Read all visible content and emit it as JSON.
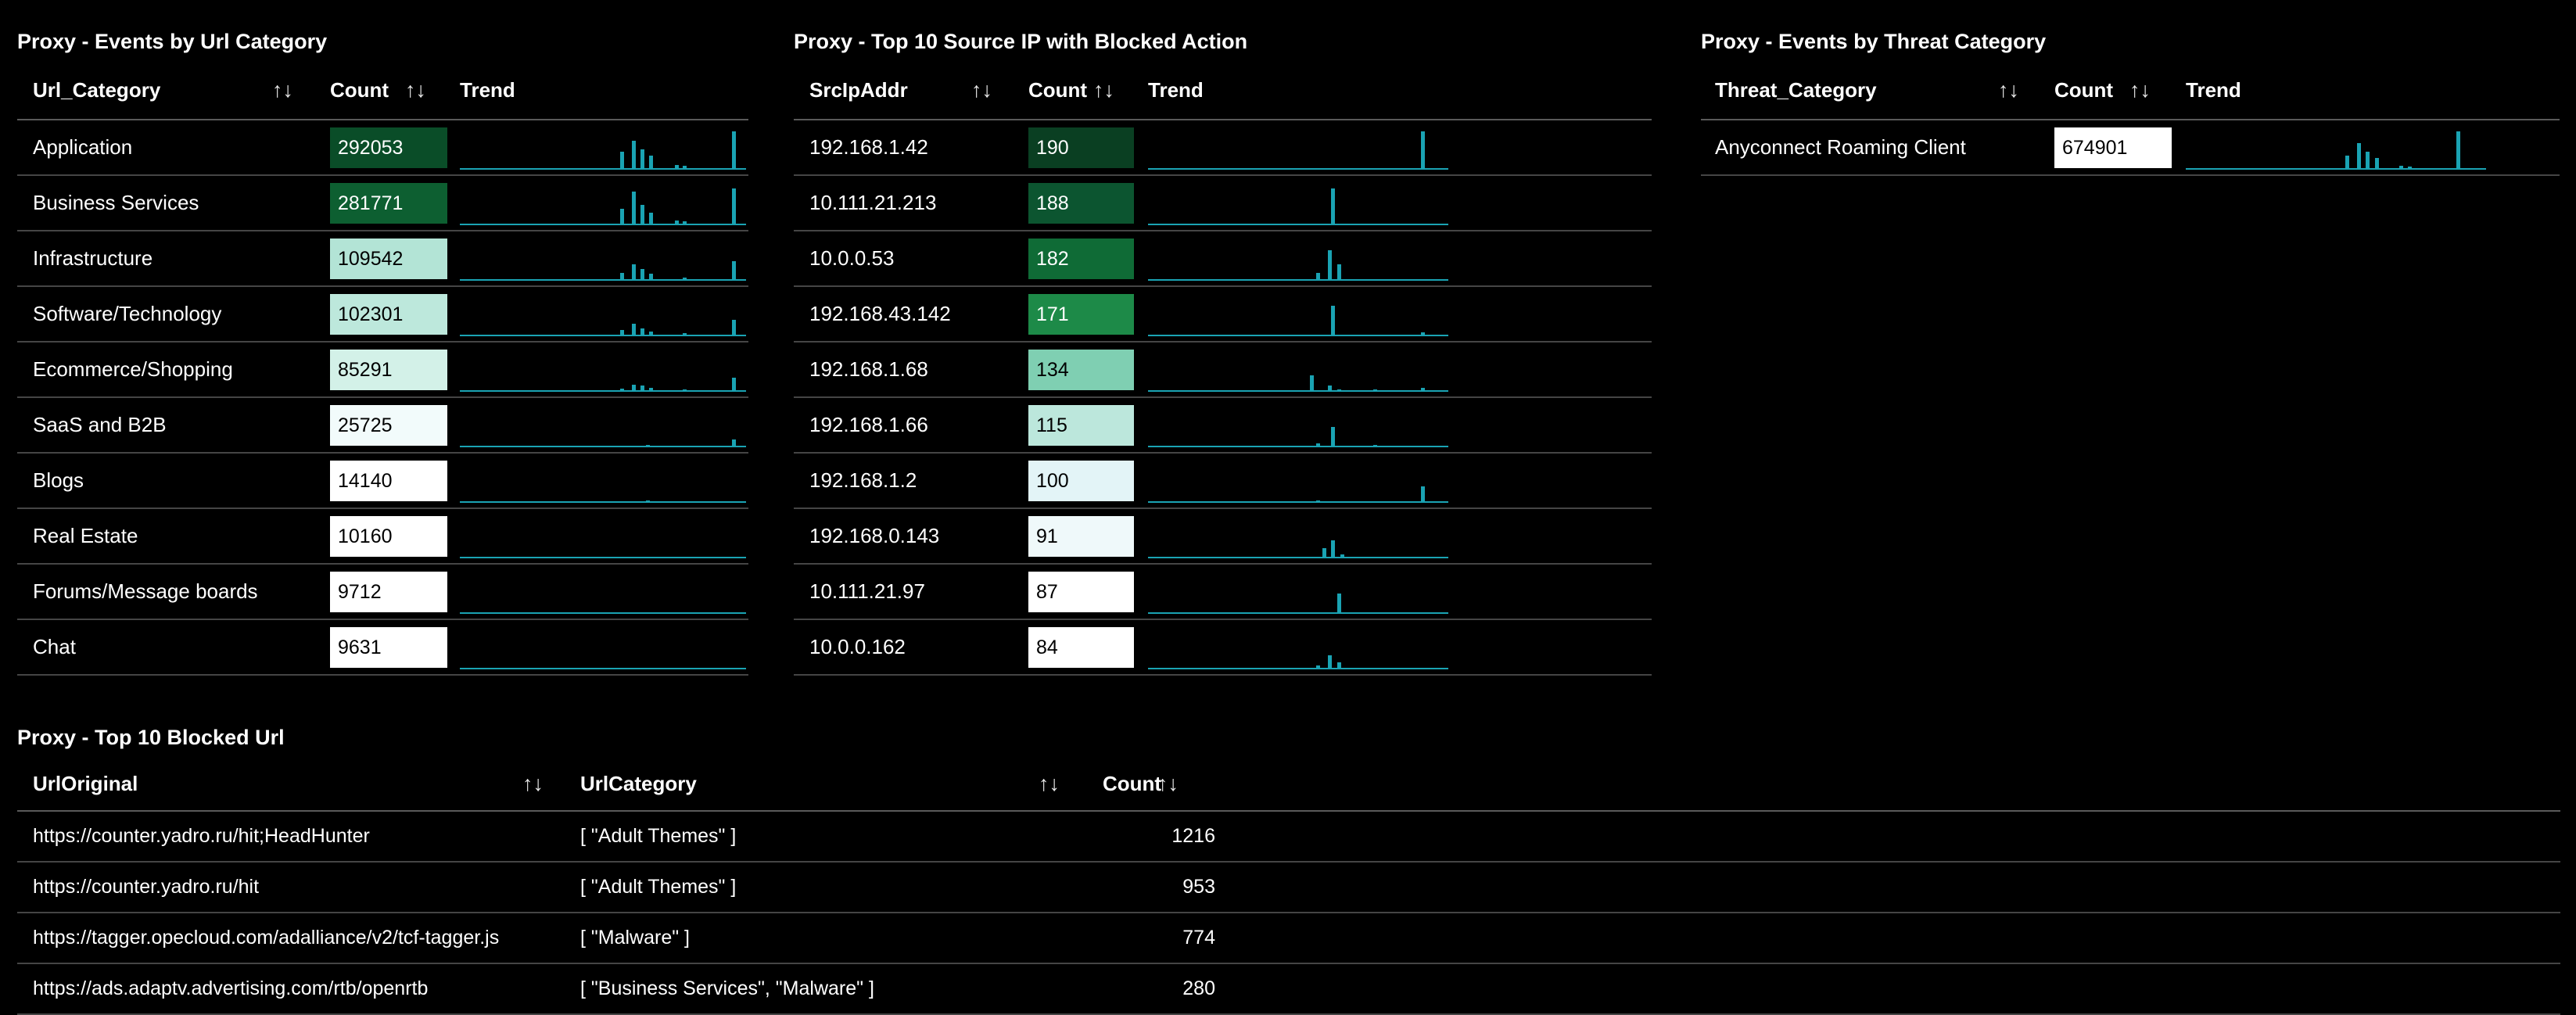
{
  "panels": {
    "url_category": {
      "title": "Proxy - Events by Url Category",
      "columns": [
        "Url_Category",
        "Count",
        "Trend"
      ],
      "rows": [
        {
          "label": "Application",
          "count": "292053",
          "shade": "#0a4d28",
          "fg": "#ffffff"
        },
        {
          "label": "Business Services",
          "count": "281771",
          "shade": "#0d5f31",
          "fg": "#ffffff"
        },
        {
          "label": "Infrastructure",
          "count": "109542",
          "shade": "#b3e4d6",
          "fg": "#000000"
        },
        {
          "label": "Software/Technology",
          "count": "102301",
          "shade": "#bde8dc",
          "fg": "#000000"
        },
        {
          "label": "Ecommerce/Shopping",
          "count": "85291",
          "shade": "#d3f1e8",
          "fg": "#000000"
        },
        {
          "label": "SaaS and B2B",
          "count": "25725",
          "shade": "#f2fbfb",
          "fg": "#000000"
        },
        {
          "label": "Blogs",
          "count": "14140",
          "shade": "#ffffff",
          "fg": "#000000"
        },
        {
          "label": "Real Estate",
          "count": "10160",
          "shade": "#ffffff",
          "fg": "#000000"
        },
        {
          "label": "Forums/Message boards",
          "count": "9712",
          "shade": "#ffffff",
          "fg": "#000000"
        },
        {
          "label": "Chat",
          "count": "9631",
          "shade": "#ffffff",
          "fg": "#000000"
        }
      ]
    },
    "src_ip": {
      "title": "Proxy - Top 10 Source IP with Blocked Action",
      "columns": [
        "SrcIpAddr",
        "Count",
        "Trend"
      ],
      "rows": [
        {
          "label": "192.168.1.42",
          "count": "190",
          "shade": "#0a3f22",
          "fg": "#ffffff"
        },
        {
          "label": "10.111.21.213",
          "count": "188",
          "shade": "#0c5530",
          "fg": "#ffffff"
        },
        {
          "label": "10.0.0.53",
          "count": "182",
          "shade": "#0f6b36",
          "fg": "#ffffff"
        },
        {
          "label": "192.168.43.142",
          "count": "171",
          "shade": "#1d8a48",
          "fg": "#ffffff"
        },
        {
          "label": "192.168.1.68",
          "count": "134",
          "shade": "#7fcfb2",
          "fg": "#000000"
        },
        {
          "label": "192.168.1.66",
          "count": "115",
          "shade": "#bce7dc",
          "fg": "#000000"
        },
        {
          "label": "192.168.1.2",
          "count": "100",
          "shade": "#e3f4f7",
          "fg": "#000000"
        },
        {
          "label": "192.168.0.143",
          "count": "91",
          "shade": "#eff9fa",
          "fg": "#000000"
        },
        {
          "label": "10.111.21.97",
          "count": "87",
          "shade": "#ffffff",
          "fg": "#000000"
        },
        {
          "label": "10.0.0.162",
          "count": "84",
          "shade": "#ffffff",
          "fg": "#000000"
        }
      ]
    },
    "threat_category": {
      "title": "Proxy - Events by Threat Category",
      "columns": [
        "Threat_Category",
        "Count",
        "Trend"
      ],
      "rows": [
        {
          "label": "Anyconnect Roaming Client",
          "count": "674901",
          "shade": "#ffffff",
          "fg": "#000000"
        }
      ]
    },
    "blocked_url": {
      "title": "Proxy - Top 10 Blocked Url",
      "columns": [
        "UrlOriginal",
        "UrlCategory",
        "Count"
      ],
      "rows": [
        {
          "url": "https://counter.yadro.ru/hit;HeadHunter",
          "category": "[ \"Adult Themes\" ]",
          "count": "1216"
        },
        {
          "url": "https://counter.yadro.ru/hit",
          "category": "[ \"Adult Themes\" ]",
          "count": "953"
        },
        {
          "url": "https://tagger.opecloud.com/adalliance/v2/tcf-tagger.js",
          "category": "[ \"Malware\" ]",
          "count": "774"
        },
        {
          "url": "https://ads.adaptv.advertising.com/rtb/openrtb",
          "category": "[ \"Business Services\", \"Malware\" ]",
          "count": "280"
        }
      ]
    }
  },
  "icons": {
    "sort": "sort-arrows-icon"
  },
  "sort_glyph": "↑↓",
  "colors": {
    "trend": "#1aa3b3",
    "background": "#000000"
  },
  "trends": {
    "url_category": [
      [
        {
          "p": 0.56,
          "h": 0.45
        },
        {
          "p": 0.6,
          "h": 0.72
        },
        {
          "p": 0.63,
          "h": 0.5
        },
        {
          "p": 0.66,
          "h": 0.35
        },
        {
          "p": 0.75,
          "h": 0.12
        },
        {
          "p": 0.78,
          "h": 0.1
        },
        {
          "p": 0.95,
          "h": 0.95
        }
      ],
      [
        {
          "p": 0.56,
          "h": 0.4
        },
        {
          "p": 0.6,
          "h": 0.82
        },
        {
          "p": 0.63,
          "h": 0.5
        },
        {
          "p": 0.66,
          "h": 0.3
        },
        {
          "p": 0.75,
          "h": 0.12
        },
        {
          "p": 0.78,
          "h": 0.1
        },
        {
          "p": 0.95,
          "h": 0.9
        }
      ],
      [
        {
          "p": 0.56,
          "h": 0.2
        },
        {
          "p": 0.6,
          "h": 0.4
        },
        {
          "p": 0.63,
          "h": 0.28
        },
        {
          "p": 0.66,
          "h": 0.18
        },
        {
          "p": 0.78,
          "h": 0.08
        },
        {
          "p": 0.95,
          "h": 0.48
        }
      ],
      [
        {
          "p": 0.56,
          "h": 0.15
        },
        {
          "p": 0.6,
          "h": 0.3
        },
        {
          "p": 0.63,
          "h": 0.2
        },
        {
          "p": 0.66,
          "h": 0.12
        },
        {
          "p": 0.78,
          "h": 0.08
        },
        {
          "p": 0.95,
          "h": 0.4
        }
      ],
      [
        {
          "p": 0.56,
          "h": 0.08
        },
        {
          "p": 0.6,
          "h": 0.18
        },
        {
          "p": 0.63,
          "h": 0.15
        },
        {
          "p": 0.66,
          "h": 0.1
        },
        {
          "p": 0.78,
          "h": 0.06
        },
        {
          "p": 0.95,
          "h": 0.35
        }
      ],
      [
        {
          "p": 0.65,
          "h": 0.05
        },
        {
          "p": 0.95,
          "h": 0.2
        }
      ],
      [
        {
          "p": 0.65,
          "h": 0.05
        }
      ],
      [
        {
          "p": 0.65,
          "h": 0.04
        }
      ],
      [
        {
          "p": 0.65,
          "h": 0.04
        }
      ],
      [
        {
          "p": 0.65,
          "h": 0.04
        }
      ]
    ],
    "src_ip": [
      [
        {
          "p": 0.91,
          "h": 0.95
        }
      ],
      [
        {
          "p": 0.61,
          "h": 0.9
        }
      ],
      [
        {
          "p": 0.56,
          "h": 0.2
        },
        {
          "p": 0.6,
          "h": 0.75
        },
        {
          "p": 0.63,
          "h": 0.4
        }
      ],
      [
        {
          "p": 0.61,
          "h": 0.75
        },
        {
          "p": 0.91,
          "h": 0.1
        }
      ],
      [
        {
          "p": 0.54,
          "h": 0.4
        },
        {
          "p": 0.6,
          "h": 0.15
        },
        {
          "p": 0.63,
          "h": 0.06
        },
        {
          "p": 0.75,
          "h": 0.05
        },
        {
          "p": 0.91,
          "h": 0.1
        }
      ],
      [
        {
          "p": 0.56,
          "h": 0.1
        },
        {
          "p": 0.61,
          "h": 0.5
        },
        {
          "p": 0.75,
          "h": 0.06
        }
      ],
      [
        {
          "p": 0.56,
          "h": 0.05
        },
        {
          "p": 0.91,
          "h": 0.4
        }
      ],
      [
        {
          "p": 0.58,
          "h": 0.25
        },
        {
          "p": 0.61,
          "h": 0.45
        },
        {
          "p": 0.64,
          "h": 0.1
        }
      ],
      [
        {
          "p": 0.63,
          "h": 0.5
        }
      ],
      [
        {
          "p": 0.56,
          "h": 0.1
        },
        {
          "p": 0.6,
          "h": 0.35
        },
        {
          "p": 0.63,
          "h": 0.18
        }
      ]
    ],
    "threat_category": [
      [
        {
          "p": 0.53,
          "h": 0.35
        },
        {
          "p": 0.57,
          "h": 0.65
        },
        {
          "p": 0.6,
          "h": 0.45
        },
        {
          "p": 0.63,
          "h": 0.28
        },
        {
          "p": 0.71,
          "h": 0.1
        },
        {
          "p": 0.74,
          "h": 0.08
        },
        {
          "p": 0.9,
          "h": 0.95
        }
      ]
    ]
  }
}
